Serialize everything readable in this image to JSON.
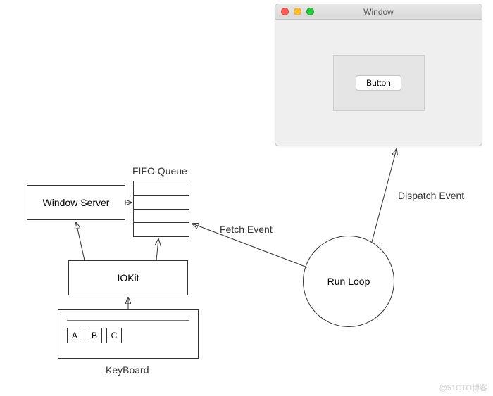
{
  "window": {
    "title": "Window",
    "button_label": "Button"
  },
  "nodes": {
    "window_server": "Window Server",
    "fifo_label": "FIFO Queue",
    "iokit": "IOKit",
    "keyboard_label": "KeyBoard",
    "run_loop": "Run Loop"
  },
  "keys": [
    "A",
    "B",
    "C"
  ],
  "edges": {
    "fetch_event": "Fetch Event",
    "dispatch_event": "Dispatch Event"
  },
  "watermark": "@51CTO博客"
}
